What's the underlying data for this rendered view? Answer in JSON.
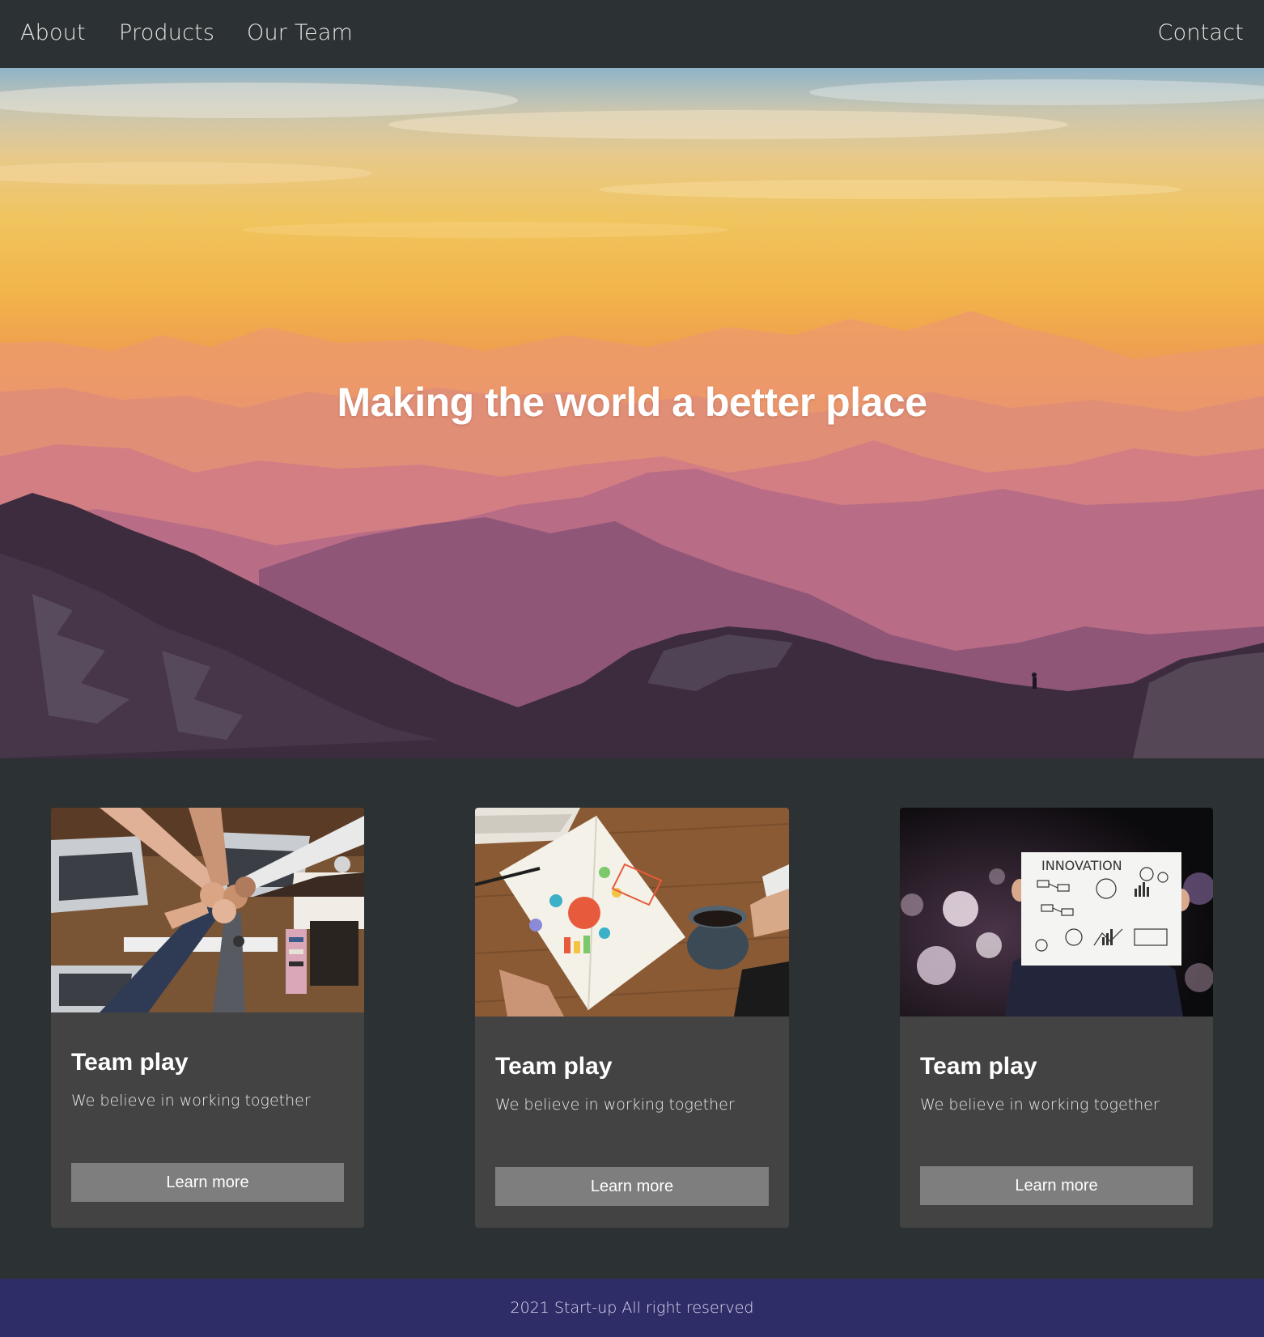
{
  "nav": {
    "items": [
      "About",
      "Products",
      "Our Team"
    ],
    "contact": "Contact"
  },
  "hero": {
    "title": "Making the world a better place",
    "image": "mountain-sunset-photo"
  },
  "cards": [
    {
      "image": "team-fist-bump-photo",
      "title": "Team play",
      "text": "We believe in working together",
      "button": "Learn more"
    },
    {
      "image": "notebook-coffee-photo",
      "title": "Team play",
      "text": "We believe in working together",
      "button": "Learn more"
    },
    {
      "image": "innovation-sign-photo",
      "title": "Team play",
      "text": "We believe in working together",
      "button": "Learn more",
      "sign_text": "INNOVATION"
    }
  ],
  "footer": {
    "text": "2021 Start-up All right reserved"
  },
  "colors": {
    "background": "#2c3133",
    "card": "#434343",
    "button": "#7e7e7e",
    "footer": "#2f2d68"
  }
}
